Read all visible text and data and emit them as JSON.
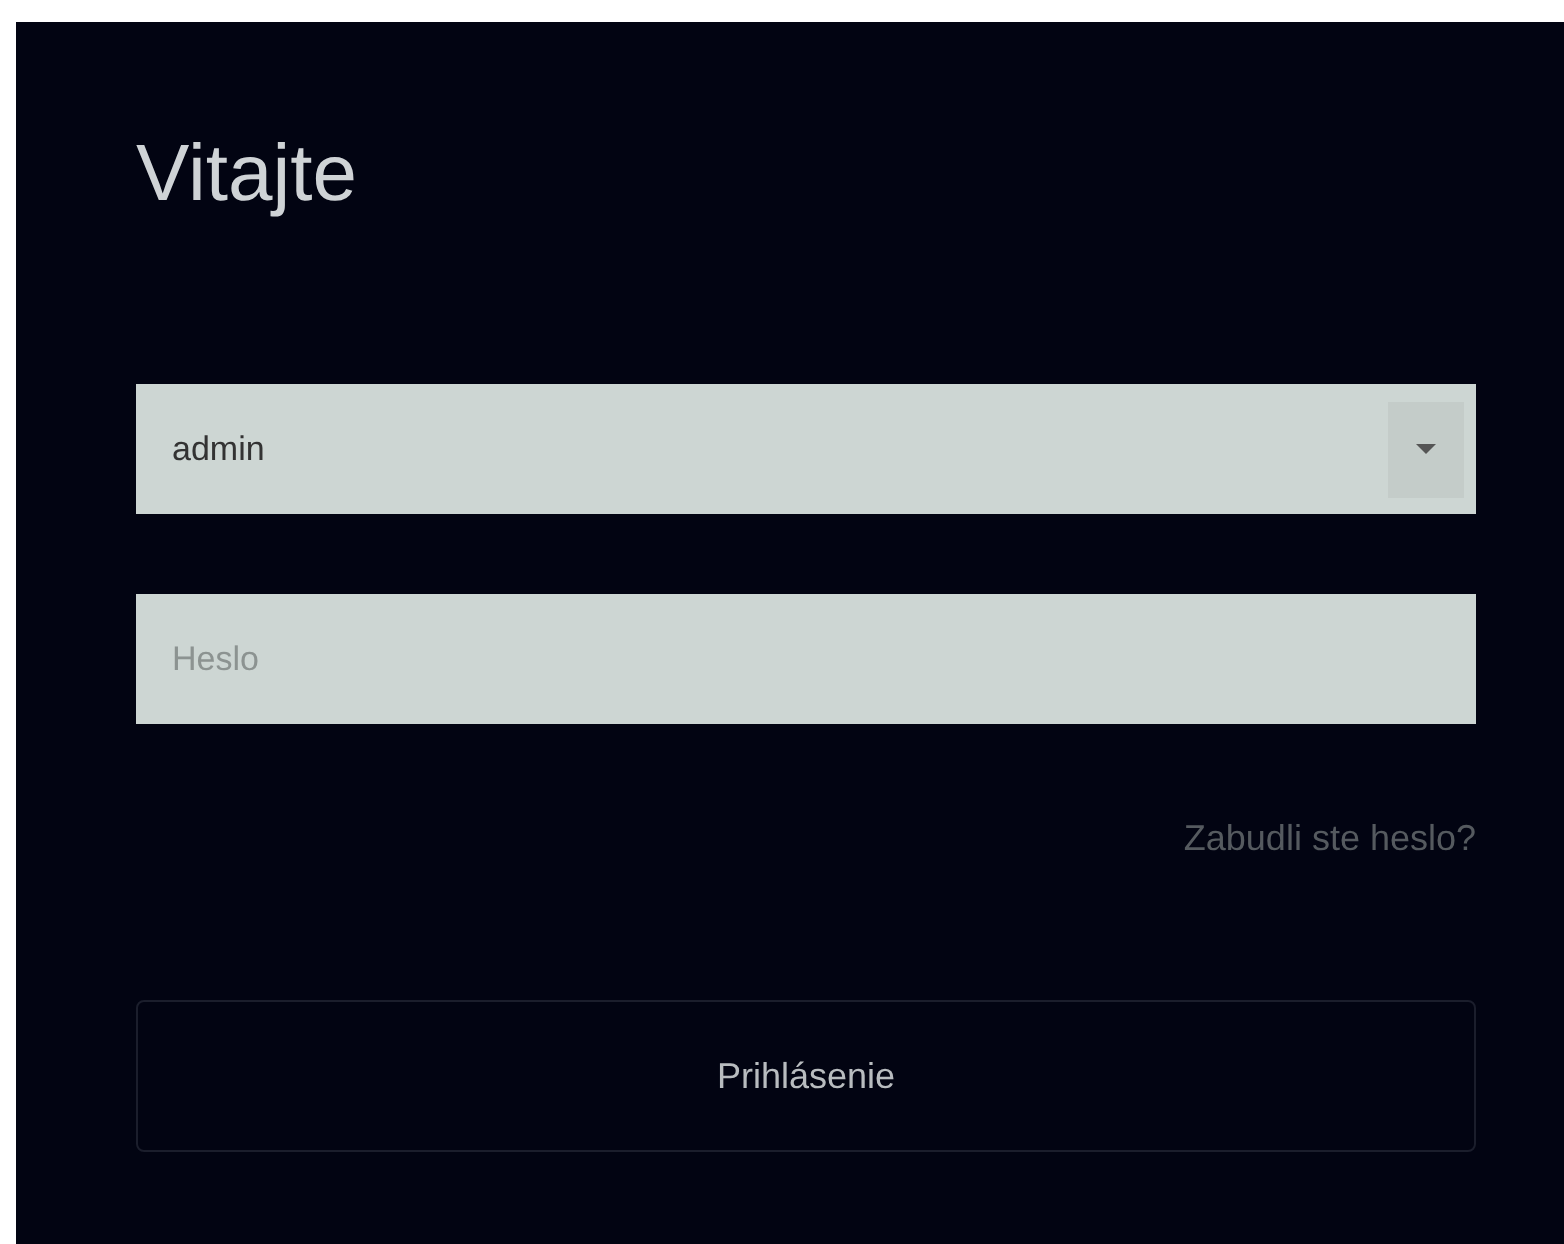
{
  "title": "Vitajte",
  "username": {
    "value": "admin"
  },
  "password": {
    "placeholder": "Heslo"
  },
  "forgot_link": "Zabudli ste heslo?",
  "login_button": "Prihlásenie"
}
